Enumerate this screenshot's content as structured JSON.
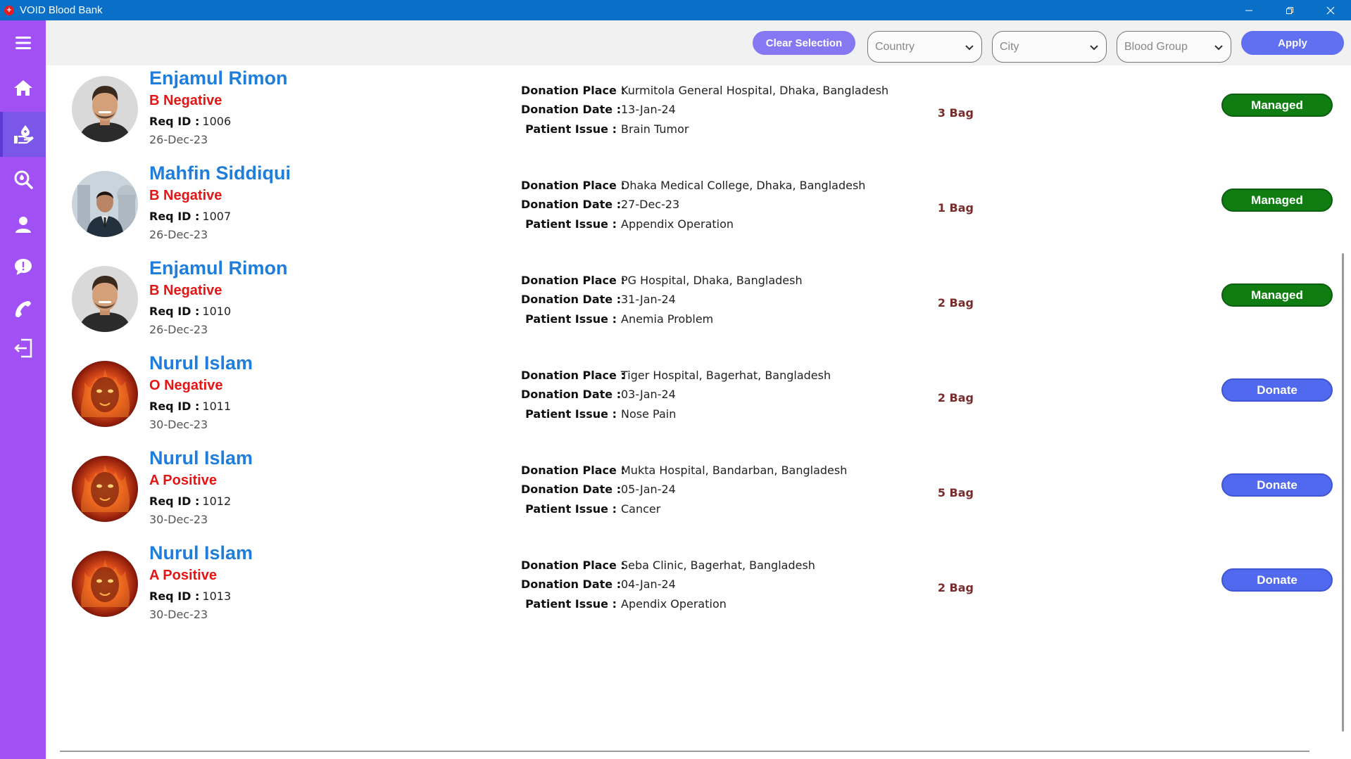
{
  "window": {
    "title": "VOID Blood Bank",
    "icon": "plus-badge-icon",
    "controls": [
      "minimize-icon",
      "restore-icon",
      "close-icon"
    ]
  },
  "sidebar": {
    "items": [
      {
        "icon": "menu-icon",
        "active": false
      },
      {
        "icon": "home-icon",
        "active": false
      },
      {
        "icon": "blood-donation-icon",
        "active": true
      },
      {
        "icon": "search-icon",
        "active": false
      },
      {
        "icon": "user-icon",
        "active": false
      },
      {
        "icon": "chat-icon",
        "active": false
      },
      {
        "icon": "phone-icon",
        "active": false
      },
      {
        "icon": "logout-icon",
        "active": false
      }
    ]
  },
  "toolbar": {
    "clear_label": "Clear Selection",
    "country_placeholder": "Country",
    "city_placeholder": "City",
    "blood_group_placeholder": "Blood Group",
    "apply_label": "Apply"
  },
  "labels": {
    "req_id": "Req ID :",
    "donation_place": "Donation Place :",
    "donation_date": "Donation Date :",
    "patient_issue": "Patient Issue :"
  },
  "colors": {
    "sidebar": "#a150f6",
    "title_bar": "#0a6fc7",
    "name": "#1f7ddc",
    "blood_group": "#e31515",
    "managed": "#0f7d12",
    "donate": "#5169ee"
  },
  "requests": [
    {
      "name": "Enjamul Rimon",
      "blood_group": "B Negative",
      "req_id": "1006",
      "req_date": "26-Dec-23",
      "place": "Kurmitola General Hospital, Dhaka, Bangladesh",
      "date": "13-Jan-24",
      "issue": "Brain Tumor",
      "bags": "3 Bag",
      "status": "Managed",
      "avatar": "man-portrait"
    },
    {
      "name": "Mahfin Siddiqui",
      "blood_group": "B Negative",
      "req_id": "1007",
      "req_date": "26-Dec-23",
      "place": "Dhaka Medical College, Dhaka, Bangladesh",
      "date": "27-Dec-23",
      "issue": "Appendix Operation",
      "bags": "1 Bag",
      "status": "Managed",
      "avatar": "man-suit-portrait"
    },
    {
      "name": "Enjamul Rimon",
      "blood_group": "B Negative",
      "req_id": "1010",
      "req_date": "26-Dec-23",
      "place": "PG Hospital, Dhaka, Bangladesh",
      "date": "31-Jan-24",
      "issue": "Anemia Problem",
      "bags": "2 Bag",
      "status": "Managed",
      "avatar": "man-portrait"
    },
    {
      "name": "Nurul Islam",
      "blood_group": "O Negative",
      "req_id": "1011",
      "req_date": "30-Dec-23",
      "place": "Tiger Hospital, Bagerhat, Bangladesh",
      "date": "03-Jan-24",
      "issue": "Nose Pain",
      "bags": "2 Bag",
      "status": "Donate",
      "avatar": "fire-face"
    },
    {
      "name": "Nurul Islam",
      "blood_group": "A Positive",
      "req_id": "1012",
      "req_date": "30-Dec-23",
      "place": "Mukta Hospital, Bandarban, Bangladesh",
      "date": "05-Jan-24",
      "issue": "Cancer",
      "bags": "5 Bag",
      "status": "Donate",
      "avatar": "fire-face"
    },
    {
      "name": "Nurul Islam",
      "blood_group": "A Positive",
      "req_id": "1013",
      "req_date": "30-Dec-23",
      "place": "Seba Clinic, Bagerhat, Bangladesh",
      "date": "04-Jan-24",
      "issue": "Apendix Operation",
      "bags": "2 Bag",
      "status": "Donate",
      "avatar": "fire-face"
    }
  ]
}
